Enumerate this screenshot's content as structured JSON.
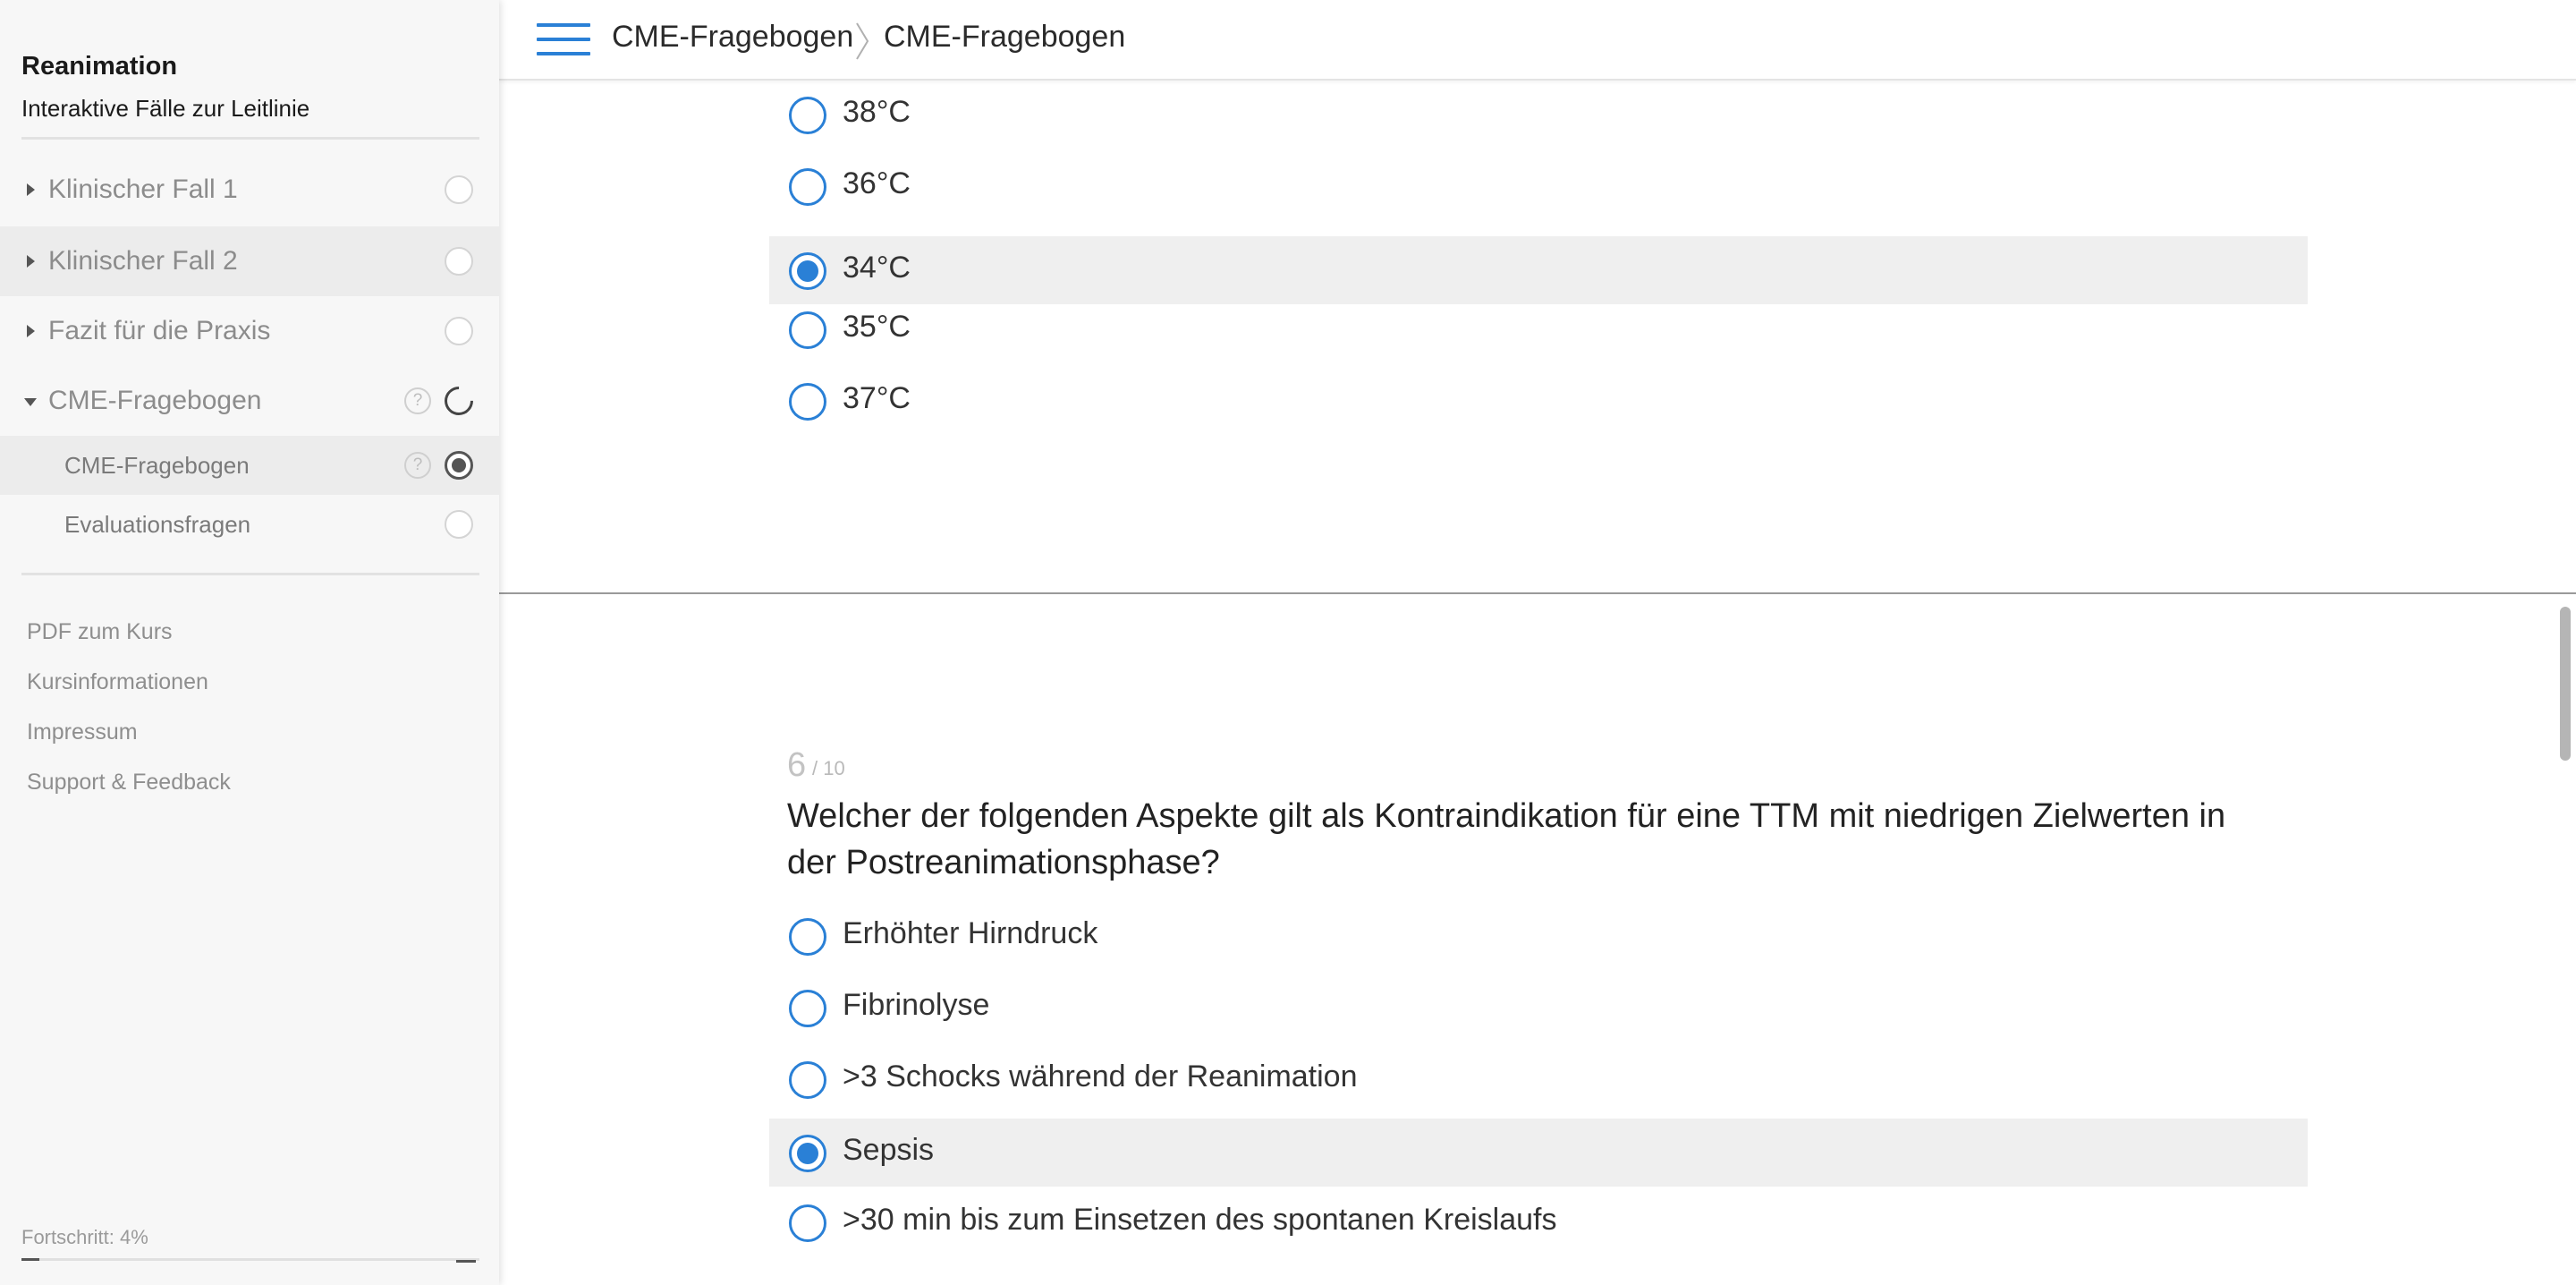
{
  "sidebar": {
    "course_title": "Reanimation",
    "course_subtitle": "Interaktive Fälle zur Leitlinie",
    "nav": [
      {
        "label": "Klinischer Fall 1"
      },
      {
        "label": "Klinischer Fall 2"
      },
      {
        "label": "Fazit für die Praxis"
      },
      {
        "label": "CME-Fragebogen"
      },
      {
        "label": "CME-Fragebogen"
      },
      {
        "label": "Evaluationsfragen"
      }
    ],
    "help_glyph": "?",
    "links": [
      "PDF zum Kurs",
      "Kursinformationen",
      "Impressum",
      "Support & Feedback"
    ],
    "progress_label": "Fortschritt: 4%",
    "progress_value": 0.04
  },
  "header": {
    "breadcrumb": [
      "CME-Fragebogen",
      "CME-Fragebogen"
    ]
  },
  "question5": {
    "options": [
      {
        "label": "38°C",
        "selected": false
      },
      {
        "label": "36°C",
        "selected": false
      },
      {
        "label": "34°C",
        "selected": true
      },
      {
        "label": "35°C",
        "selected": false
      },
      {
        "label": "37°C",
        "selected": false
      }
    ]
  },
  "question6": {
    "number": "6",
    "total": "/ 10",
    "text": "Welcher der folgenden Aspekte gilt als Kontraindikation für eine TTM mit niedrigen Zielwerten in der Postreanimationsphase?",
    "options": [
      {
        "label": "Erhöhter Hirndruck",
        "selected": false
      },
      {
        "label": "Fibrinolyse",
        "selected": false
      },
      {
        "label": ">3 Schocks während der Reanimation",
        "selected": false
      },
      {
        "label": "Sepsis",
        "selected": true
      },
      {
        "label": ">30 min bis zum Einsetzen des spontanen Kreislaufs",
        "selected": false
      }
    ]
  },
  "colors": {
    "accent": "#2a80d6",
    "sidebar_bg": "#f7f7f7",
    "selected_bg": "#efefef"
  }
}
